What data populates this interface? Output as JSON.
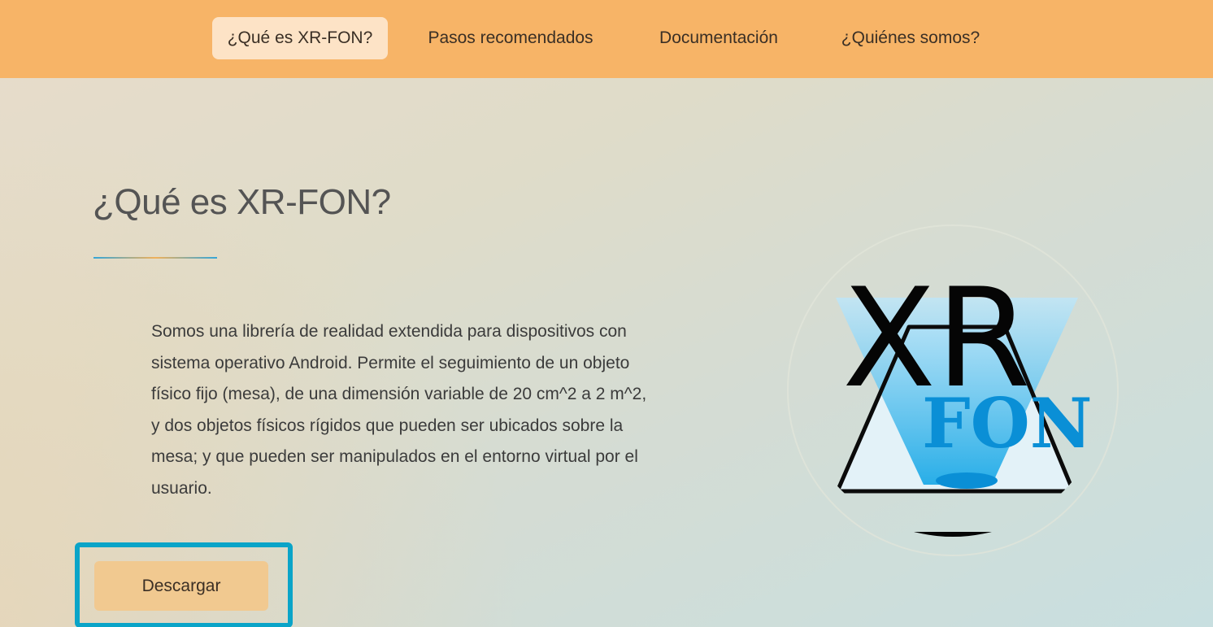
{
  "nav": {
    "items": [
      {
        "label": "¿Qué es XR-FON?",
        "active": true
      },
      {
        "label": "Pasos recomendados",
        "active": false
      },
      {
        "label": "Documentación",
        "active": false
      },
      {
        "label": "¿Quiénes somos?",
        "active": false
      }
    ]
  },
  "main": {
    "title": "¿Qué es XR-FON?",
    "description": "Somos una librería de realidad extendida para dispositivos con sistema operativo Android. Permite el seguimiento de un objeto físico fijo (mesa), de una dimensión variable de 20 cm^2 a 2 m^2, y dos objetos físicos rígidos que pueden ser ubicados sobre la mesa; y que pueden ser manipulados en el entorno virtual por el usuario.",
    "download_label": "Descargar"
  },
  "logo": {
    "top_text": "XR",
    "bottom_text": "FON",
    "icon": "xr-fon-logo-icon"
  },
  "colors": {
    "navbar": "#f7b467",
    "nav_active": "#fde3c6",
    "button": "#f1c990",
    "highlight": "#0aa4c8",
    "logo_blue": "#0a8fd6"
  }
}
